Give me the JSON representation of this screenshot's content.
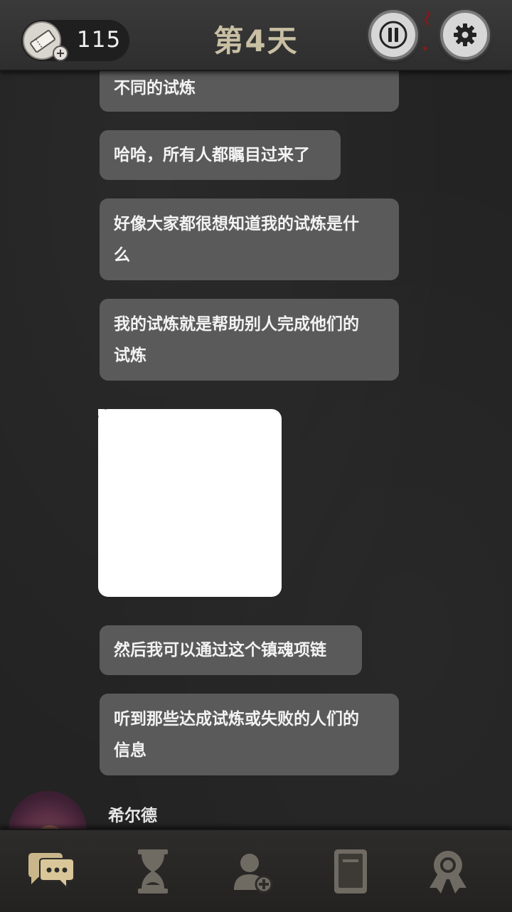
{
  "header": {
    "ticket_count": "115",
    "day_title": "第4天"
  },
  "chat": {
    "messages": [
      {
        "lines": [
          "不同的试炼"
        ]
      },
      {
        "lines": [
          "哈哈，所有人都瞩目过来了"
        ]
      },
      {
        "lines": [
          "好像大家都很想知道我的试炼是什",
          "么"
        ]
      },
      {
        "lines": [
          "我的试炼就是帮助别人完成他们的",
          "试炼"
        ]
      },
      {
        "lines": [
          "然后我可以通过这个镇魂项链"
        ]
      },
      {
        "lines": [
          "听到那些达成试炼或失败的人们的",
          "信息"
        ]
      }
    ],
    "speaker_name": "希尔德"
  },
  "colors": {
    "background": "#232323",
    "bubble": "#5a5a5a",
    "accent_gold": "#c9b68a",
    "nav_icon": "#6f6a62"
  },
  "nav": {
    "items": [
      {
        "icon": "chat-bubbles-icon",
        "active": true
      },
      {
        "icon": "hourglass-icon",
        "active": false
      },
      {
        "icon": "add-friend-icon",
        "active": false
      },
      {
        "icon": "book-icon",
        "active": false
      },
      {
        "icon": "award-badge-icon",
        "active": false
      }
    ]
  }
}
